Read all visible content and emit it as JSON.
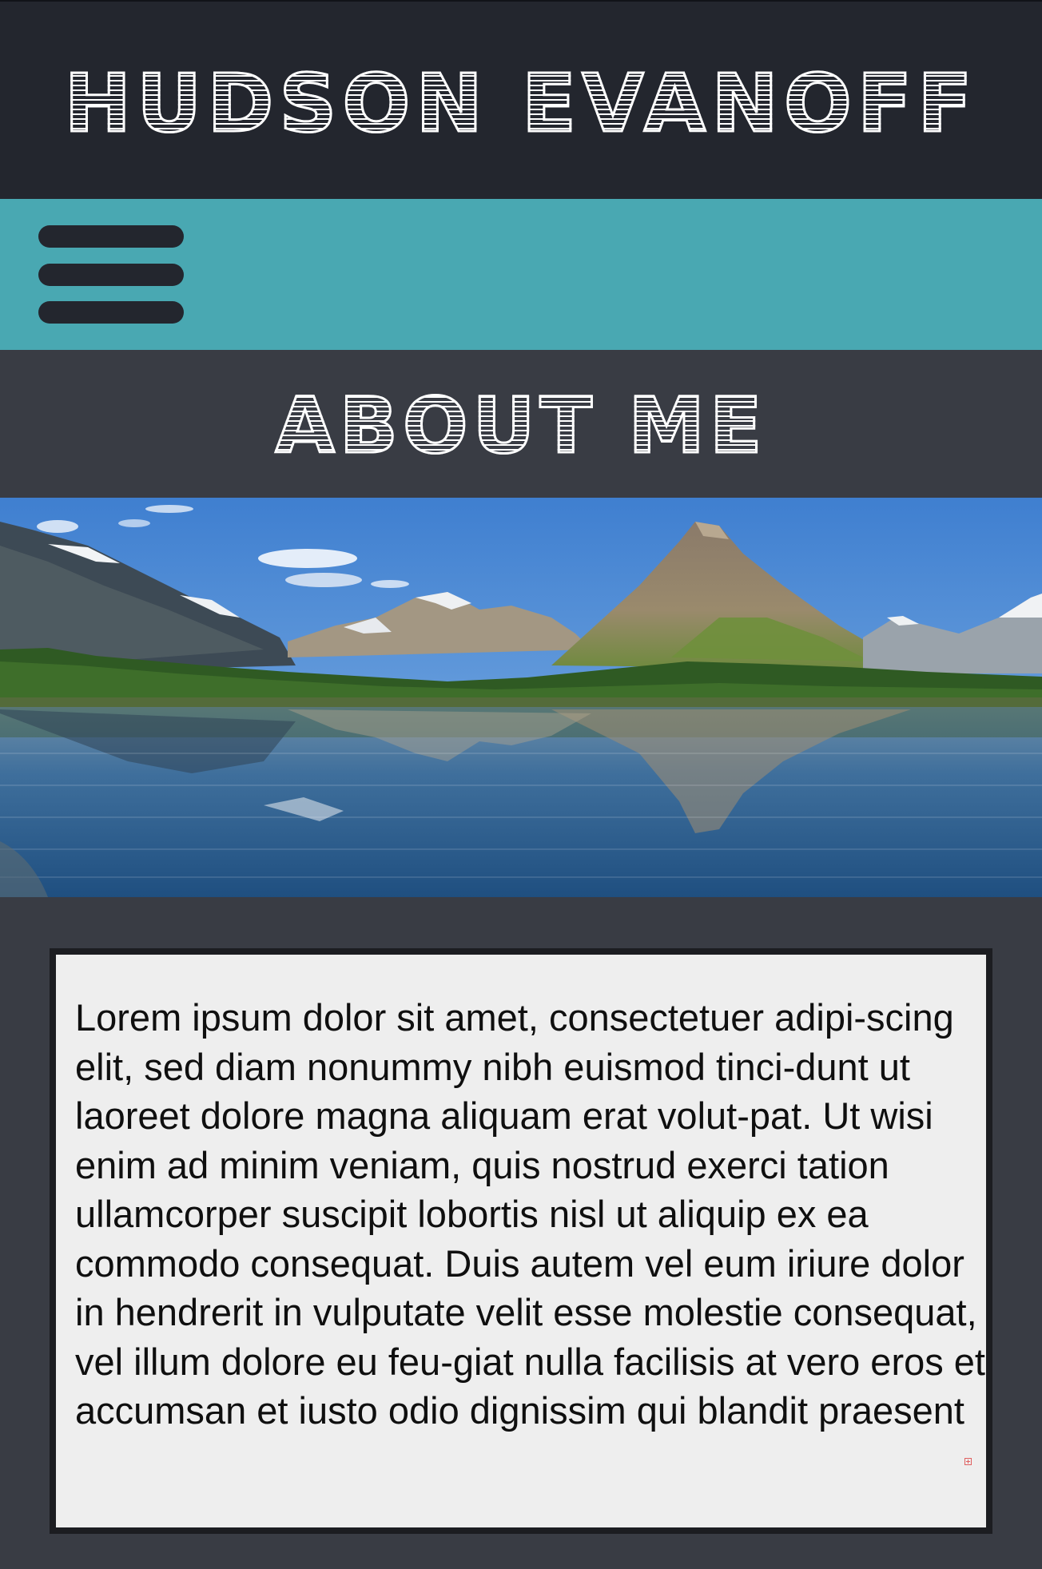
{
  "header": {
    "title": "HUDSON EVANOFF"
  },
  "nav": {
    "menu_icon": "hamburger-menu-icon"
  },
  "section": {
    "title": "ABOUT ME"
  },
  "hero_image": {
    "subject": "mountain-lake-landscape"
  },
  "content": {
    "body": "Lorem ipsum dolor sit amet, consectetuer adipi-scing elit, sed diam nonummy nibh euismod tinci-dunt ut laoreet dolore magna aliquam erat volut-pat. Ut wisi enim ad minim veniam, quis nostrud exerci tation ullamcorper suscipit lobortis nisl ut aliquip ex ea commodo consequat. Duis autem vel eum iriure dolor in hendrerit in vulputate velit esse molestie consequat, vel illum dolore eu feu-giat nulla facilisis at vero eros et accumsan et iusto odio dignissim qui blandit praesent",
    "overflow_icon": "text-overflow-icon"
  },
  "colors": {
    "header_bg": "#23262e",
    "nav_bg": "#49a8b2",
    "page_bg": "#393c44",
    "card_bg": "#eeeeee",
    "card_border": "#1c1d21"
  }
}
